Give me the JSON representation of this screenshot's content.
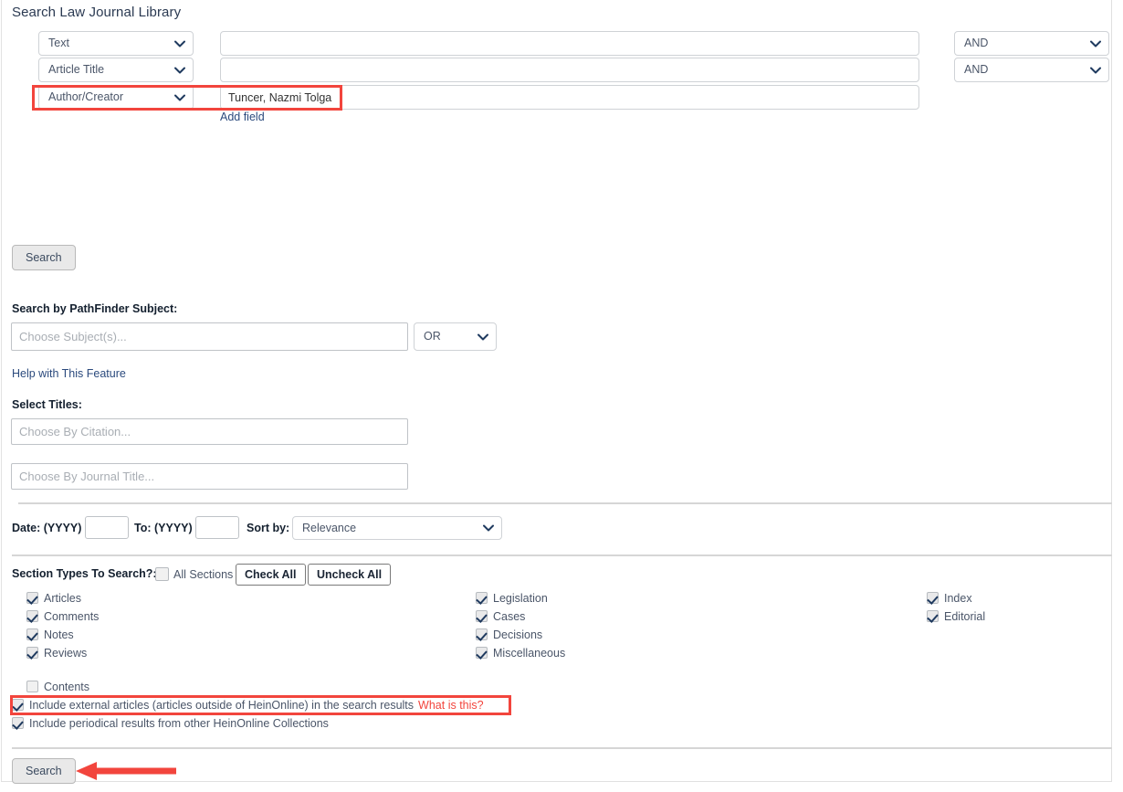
{
  "page": {
    "title": "Search Law Journal Library"
  },
  "search_fields": {
    "rows": [
      {
        "field_select": "Text",
        "value": "",
        "operator": "AND"
      },
      {
        "field_select": "Article Title",
        "value": "",
        "operator": "AND"
      },
      {
        "field_select": "Author/Creator",
        "value": "Tuncer, Nazmi Tolga",
        "operator": ""
      }
    ],
    "add_field_label": "Add field",
    "search_button_top": "Search"
  },
  "pathfinder": {
    "label": "Search by PathFinder Subject:",
    "subject_placeholder": "Choose Subject(s)...",
    "operator": "OR",
    "help_link": "Help with This Feature"
  },
  "select_titles": {
    "label": "Select Titles:",
    "citation_placeholder": "Choose By Citation...",
    "journal_placeholder": "Choose By Journal Title..."
  },
  "date_row": {
    "date_label": "Date: (YYYY)",
    "date_from": "",
    "to_label": "To: (YYYY)",
    "date_to": "",
    "sort_label": "Sort by:",
    "sort_value": "Relevance"
  },
  "sections": {
    "label": "Section Types To Search?:",
    "all_sections_label": "All Sections",
    "all_sections_checked": false,
    "check_all_label": "Check All",
    "uncheck_all_label": "Uncheck All",
    "column1": [
      {
        "label": "Articles",
        "checked": true
      },
      {
        "label": "Comments",
        "checked": true
      },
      {
        "label": "Notes",
        "checked": true
      },
      {
        "label": "Reviews",
        "checked": true
      }
    ],
    "column2": [
      {
        "label": "Legislation",
        "checked": true
      },
      {
        "label": "Cases",
        "checked": true
      },
      {
        "label": "Decisions",
        "checked": true
      },
      {
        "label": "Miscellaneous",
        "checked": true
      }
    ],
    "column3": [
      {
        "label": "Index",
        "checked": true
      },
      {
        "label": "Editorial",
        "checked": true
      }
    ],
    "contents": {
      "label": "Contents",
      "checked": false
    }
  },
  "extras": {
    "external_articles": {
      "label": "Include external articles (articles outside of HeinOnline) in the search results",
      "help_label": "What is this?",
      "checked": true
    },
    "periodical_results": {
      "label": "Include periodical results from other HeinOnline Collections",
      "checked": true
    }
  },
  "footer": {
    "search_button": "Search"
  },
  "colors": {
    "accent_red": "#f2453d",
    "link_blue": "#2b4a7d",
    "check_navy": "#1f3a5f"
  }
}
